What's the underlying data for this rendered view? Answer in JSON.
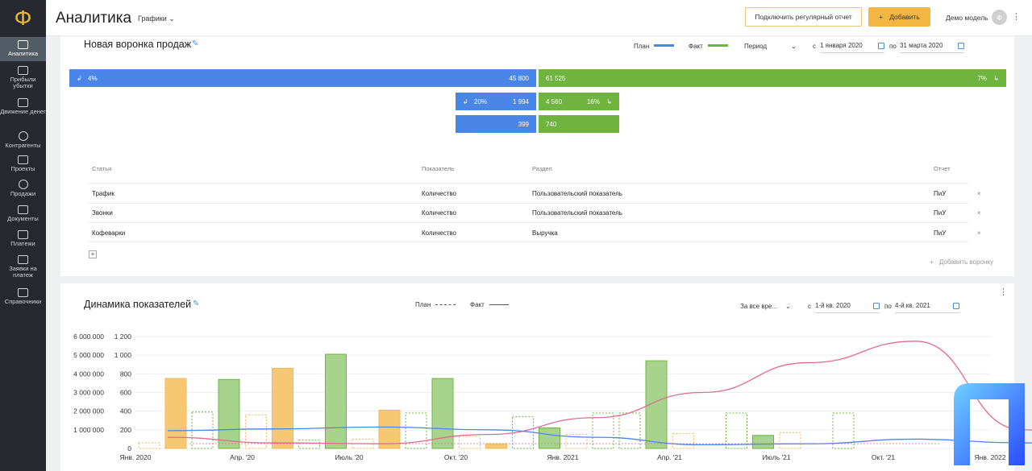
{
  "app": {
    "logo_glyph": "Ф",
    "title": "Аналитика",
    "crumb": "Графики"
  },
  "sidebar": {
    "items": [
      {
        "label": "Аналитика",
        "icon": "analytics-icon"
      },
      {
        "label": "Прибыли убытки",
        "icon": "profit-loss-icon"
      },
      {
        "label": "Движение денег",
        "icon": "cashflow-icon"
      },
      {
        "label": "Контрагенты",
        "icon": "contractors-icon"
      },
      {
        "label": "Проекты",
        "icon": "projects-icon"
      },
      {
        "label": "Продажи",
        "icon": "sales-icon"
      },
      {
        "label": "Документы",
        "icon": "documents-icon"
      },
      {
        "label": "Платежи",
        "icon": "payments-icon"
      },
      {
        "label": "Заявки на платеж",
        "icon": "requests-icon"
      },
      {
        "label": "Справочники",
        "icon": "folder-icon"
      }
    ]
  },
  "header": {
    "report_button": "Подключить регулярный отчет",
    "add_button": "Добавить",
    "add_plus": "+",
    "user": "Демо модель",
    "avatar_glyph": "Ф",
    "menu_glyph": "⋮"
  },
  "funnel": {
    "title": "Новая воронка продаж",
    "legend_plan": "План",
    "legend_fact": "Факт",
    "period_label": "Период",
    "from_label": "с",
    "from_date": "1 января 2020",
    "to_label": "по",
    "to_date": "31 марта 2020",
    "rows": [
      {
        "plan_pct": "4%",
        "plan_value": "45 800",
        "fact_value": "61 525",
        "fact_pct": "7%"
      },
      {
        "plan_pct": "20%",
        "plan_value": "1 994",
        "fact_value": "4 560",
        "fact_pct": "16%"
      },
      {
        "plan_value": "399",
        "fact_value": "740"
      }
    ],
    "table": {
      "headers": [
        "Статья",
        "Показатель",
        "Раздел",
        "Отчет"
      ],
      "rows": [
        [
          "Трафик",
          "Количество",
          "Пользовательский показатель",
          "ПиУ"
        ],
        [
          "Звонки",
          "Количество",
          "Пользовательский показатель",
          "ПиУ"
        ],
        [
          "Кофеварки",
          "Количество",
          "Выручка",
          "ПиУ"
        ]
      ]
    },
    "add_funnel": "Добавить воронку",
    "remove_glyph": "×",
    "add_row_glyph": "+"
  },
  "dynamics": {
    "title": "Динамика показателей",
    "legend_plan": "План",
    "legend_fact": "Факт",
    "period_label": "За все вре...",
    "from_label": "с",
    "from_date": "1-й кв. 2020",
    "to_label": "по",
    "to_date": "4-й кв. 2021",
    "menu_glyph": "⋮"
  },
  "colors": {
    "plan_blue": "#4a86e8",
    "fact_green": "#6fb43f",
    "orange": "#f7c873",
    "pink_line": "#e06a94",
    "blue_line": "#4a86e8",
    "accent": "#f3b640"
  },
  "chart_data": {
    "type": "bar",
    "left_axis_ticks": [
      "6 000 000",
      "5 000 000",
      "4 000 000",
      "3 000 000",
      "2 000 000",
      "1 000 000",
      ""
    ],
    "right_axis_ticks": [
      "1 200",
      "1 000",
      "800",
      "600",
      "400",
      "200",
      "0"
    ],
    "x_labels": [
      "Янв. 2020",
      "Апр. '20",
      "Июль '20",
      "Окт. '20",
      "Янв. 2021",
      "Апр. '21",
      "Июль '21",
      "Окт. '21",
      "Янв. 2022"
    ],
    "right_ylim": [
      0,
      1200
    ],
    "bars": [
      {
        "period": 0,
        "series": "orange-plan",
        "value": 60
      },
      {
        "period": 0,
        "series": "orange-fact",
        "value": 750
      },
      {
        "period": 0,
        "series": "green-plan",
        "value": 390
      },
      {
        "period": 0,
        "series": "green-fact",
        "value": 740
      },
      {
        "period": 1,
        "series": "orange-fact",
        "value": 860
      },
      {
        "period": 1,
        "series": "orange-plan",
        "value": 360
      },
      {
        "period": 1,
        "series": "green-fact",
        "value": 1010
      },
      {
        "period": 1,
        "series": "green-plan",
        "value": 90
      },
      {
        "period": 2,
        "series": "orange-fact",
        "value": 410
      },
      {
        "period": 2,
        "series": "green-plan",
        "value": 380
      },
      {
        "period": 2,
        "series": "green-fact",
        "value": 750
      },
      {
        "period": 2,
        "series": "orange-plan",
        "value": 100
      },
      {
        "period": 3,
        "series": "green-plan",
        "value": 340
      },
      {
        "period": 3,
        "series": "green-fact",
        "value": 220
      },
      {
        "period": 3,
        "series": "orange-plan",
        "value": 130
      },
      {
        "period": 3,
        "series": "orange-fact",
        "value": 50
      },
      {
        "period": 4,
        "series": "green-plan",
        "value": 380
      },
      {
        "period": 4,
        "series": "green-fact",
        "value": 940
      },
      {
        "period": 4,
        "series": "orange-plan",
        "value": 150
      },
      {
        "period": 4,
        "series": "green-plan2",
        "value": 380
      },
      {
        "period": 5,
        "series": "green-fact",
        "value": 140
      },
      {
        "period": 5,
        "series": "orange-plan",
        "value": 160
      },
      {
        "period": 5,
        "series": "green-plan",
        "value": 380
      },
      {
        "period": 6,
        "series": "orange-plan",
        "value": 170
      },
      {
        "period": 6,
        "series": "green-plan",
        "value": 380
      }
    ],
    "lines": [
      {
        "name": "",
        "color": "pink",
        "points": [
          [
            0.5,
            120
          ],
          [
            1,
            60
          ],
          [
            1.5,
            50
          ],
          [
            2,
            150
          ],
          [
            2.5,
            330
          ],
          [
            3,
            600
          ],
          [
            3.5,
            920
          ],
          [
            4,
            1150
          ],
          [
            4.5,
            200
          ],
          [
            5,
            0
          ]
        ]
      },
      {
        "name": "",
        "color": "blue",
        "points": [
          [
            0.5,
            190
          ],
          [
            1,
            210
          ],
          [
            1.5,
            230
          ],
          [
            2,
            200
          ],
          [
            2.5,
            120
          ],
          [
            3,
            40
          ],
          [
            3.5,
            50
          ],
          [
            4,
            100
          ],
          [
            4.5,
            60
          ],
          [
            5,
            20
          ]
        ]
      }
    ]
  }
}
